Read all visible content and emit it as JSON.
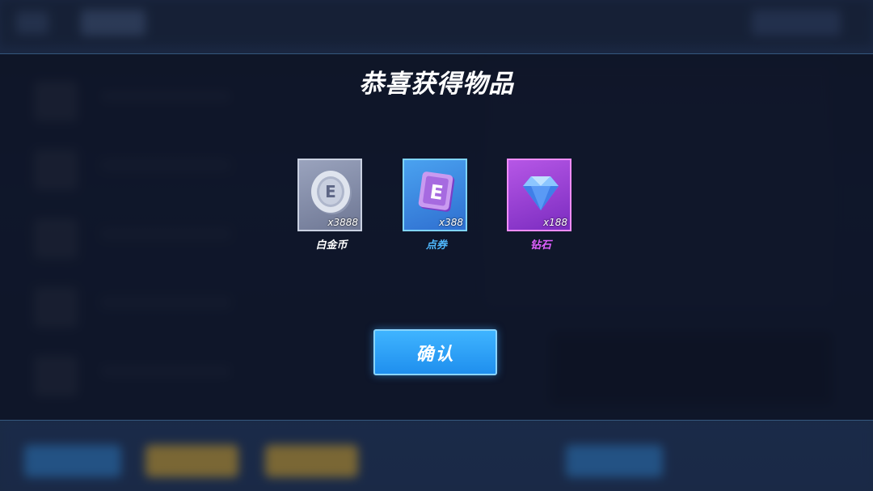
{
  "dialog": {
    "title": "恭喜获得物品",
    "confirm_label": "确认"
  },
  "rewards": [
    {
      "name": "白金币",
      "quantity": "x3888",
      "icon": "platinum-coin-icon",
      "name_color": "#ffffff",
      "frame_color": "#c9d0e0"
    },
    {
      "name": "点券",
      "quantity": "x388",
      "icon": "voucher-icon",
      "name_color": "#4fb8ff",
      "frame_color": "#7fd4ff"
    },
    {
      "name": "钻石",
      "quantity": "x188",
      "icon": "diamond-icon",
      "name_color": "#e060ff",
      "frame_color": "#f08cff"
    }
  ]
}
